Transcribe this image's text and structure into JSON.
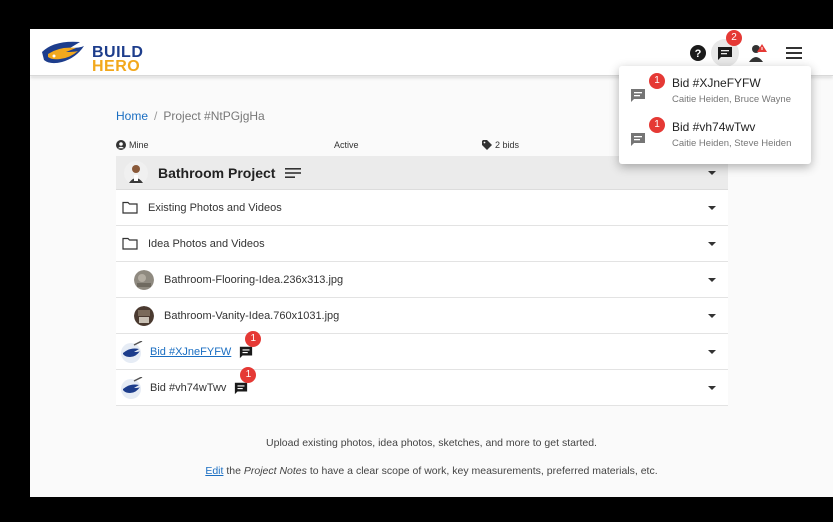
{
  "brand": {
    "line1": "BUILD",
    "line2": "HERO"
  },
  "topbar": {
    "chat_badge": "2"
  },
  "breadcrumb": {
    "home": "Home",
    "separator": "/",
    "current": "Project #NtPGjgHa"
  },
  "meta": {
    "owner": "Mine",
    "status": "Active",
    "bids": "2 bids"
  },
  "project": {
    "title": "Bathroom Project"
  },
  "rows": [
    {
      "label": "Existing Photos and Videos"
    },
    {
      "label": "Idea Photos and Videos"
    },
    {
      "label": "Bathroom-Flooring-Idea.236x313.jpg"
    },
    {
      "label": "Bathroom-Vanity-Idea.760x1031.jpg"
    }
  ],
  "bids": [
    {
      "label": "Bid #XJneFYFW",
      "badge": "1"
    },
    {
      "label": "Bid #vh74wTwv",
      "badge": "1"
    }
  ],
  "footer": {
    "line1": "Upload existing photos, idea photos, sketches, and more to get started.",
    "edit_link": "Edit",
    "line2_pre": " the ",
    "line2_em": "Project Notes",
    "line2_post": " to have a clear scope of work, key measurements, preferred materials, etc."
  },
  "dropdown": {
    "items": [
      {
        "title": "Bid #XJneFYFW",
        "subtitle": "Caitie Heiden, Bruce Wayne",
        "badge": "1"
      },
      {
        "title": "Bid #vh74wTwv",
        "subtitle": "Caitie Heiden, Steve Heiden",
        "badge": "1"
      }
    ]
  },
  "colors": {
    "link": "#1a6ec2",
    "badge": "#e53935",
    "brand_blue": "#1d3d8c",
    "brand_gold": "#f2a81d"
  }
}
